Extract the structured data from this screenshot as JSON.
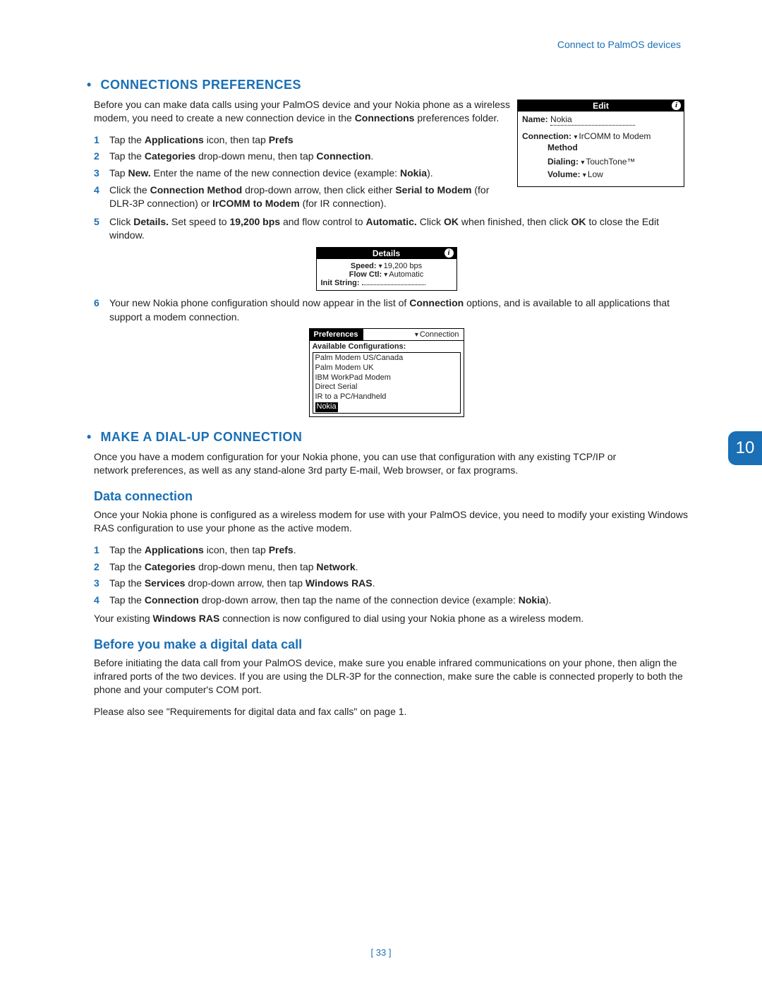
{
  "header": {
    "right": "Connect to PalmOS devices"
  },
  "chapter_badge": "10",
  "section1": {
    "title": "CONNECTIONS PREFERENCES",
    "intro_html": "Before you can make data calls using your PalmOS device and your Nokia phone as a wireless modem, you need to create a new connection device in the <b>Connections</b> preferences folder.",
    "steps": [
      "Tap the <b>Applications</b> icon, then tap <b>Prefs</b>",
      "Tap the <b>Categories</b> drop-down menu, then tap <b>Connection</b>.",
      "Tap <b>New.</b> Enter the name of the new connection device (example: <b>Nokia</b>).",
      "Click the <b>Connection Method</b> drop-down arrow, then click either <b>Serial to Modem</b> (for DLR-3P connection) or <b>IrCOMM to Modem</b> (for IR connection).",
      "Click <b>Details.</b> Set speed to <b>19,200 bps</b> and flow control to <b>Automatic.</b> Click <b>OK</b> when finished, then click <b>OK</b> to close the Edit window.",
      "Your new Nokia phone configuration should now appear in the list of <b>Connection</b> options, and is available to all applications that support a modem connection."
    ]
  },
  "edit_box": {
    "title": "Edit",
    "name_label": "Name:",
    "name_value": "Nokia",
    "conn_label": "Connection:",
    "conn_value": "IrCOMM to Modem",
    "method_label": "Method",
    "dial_label": "Dialing:",
    "dial_value": "TouchTone™",
    "vol_label": "Volume:",
    "vol_value": "Low"
  },
  "details_box": {
    "title": "Details",
    "speed_label": "Speed:",
    "speed_value": "19,200 bps",
    "flow_label": "Flow Ctl:",
    "flow_value": "Automatic",
    "init_label": "Init String:"
  },
  "prefs_box": {
    "left": "Preferences",
    "right": "Connection",
    "sub": "Available Configurations:",
    "items": [
      "Palm Modem US/Canada",
      "Palm Modem UK",
      "IBM WorkPad Modem",
      "Direct Serial",
      "IR to a PC/Handheld"
    ],
    "selected": "Nokia"
  },
  "section2": {
    "title": "MAKE A DIAL-UP CONNECTION",
    "intro": "Once you have a modem configuration for your Nokia phone, you can use that configuration with any existing TCP/IP or network preferences, as well as any stand-alone 3rd party E-mail, Web browser, or fax programs."
  },
  "sub1": {
    "title": "Data connection",
    "intro": "Once your Nokia phone is configured as a wireless modem for use with your PalmOS device, you need to modify your existing Windows RAS configuration to use your phone as the active modem.",
    "steps": [
      "Tap the <b>Applications</b> icon, then tap <b>Prefs</b>.",
      "Tap the <b>Categories</b> drop-down menu, then tap <b>Network</b>.",
      "Tap the <b>Services</b> drop-down arrow, then tap <b>Windows RAS</b>.",
      "Tap the <b>Connection</b> drop-down arrow, then tap the name of the connection device (example: <b>Nokia</b>)."
    ],
    "note": "Your existing <b>Windows RAS</b> connection is now configured to dial using your Nokia phone as a wireless modem."
  },
  "sub2": {
    "title": "Before you make a digital data call",
    "p1": "Before initiating the data call from your PalmOS device, make sure you enable infrared communications on your phone, then align the infrared ports of the two devices. If you are using the DLR-3P for the connection, make sure the cable is connected properly to both the phone and your computer's COM port.",
    "p2": "Please also see \"Requirements for digital data and fax calls\" on page 1."
  },
  "footer": {
    "page": "[ 33 ]"
  }
}
